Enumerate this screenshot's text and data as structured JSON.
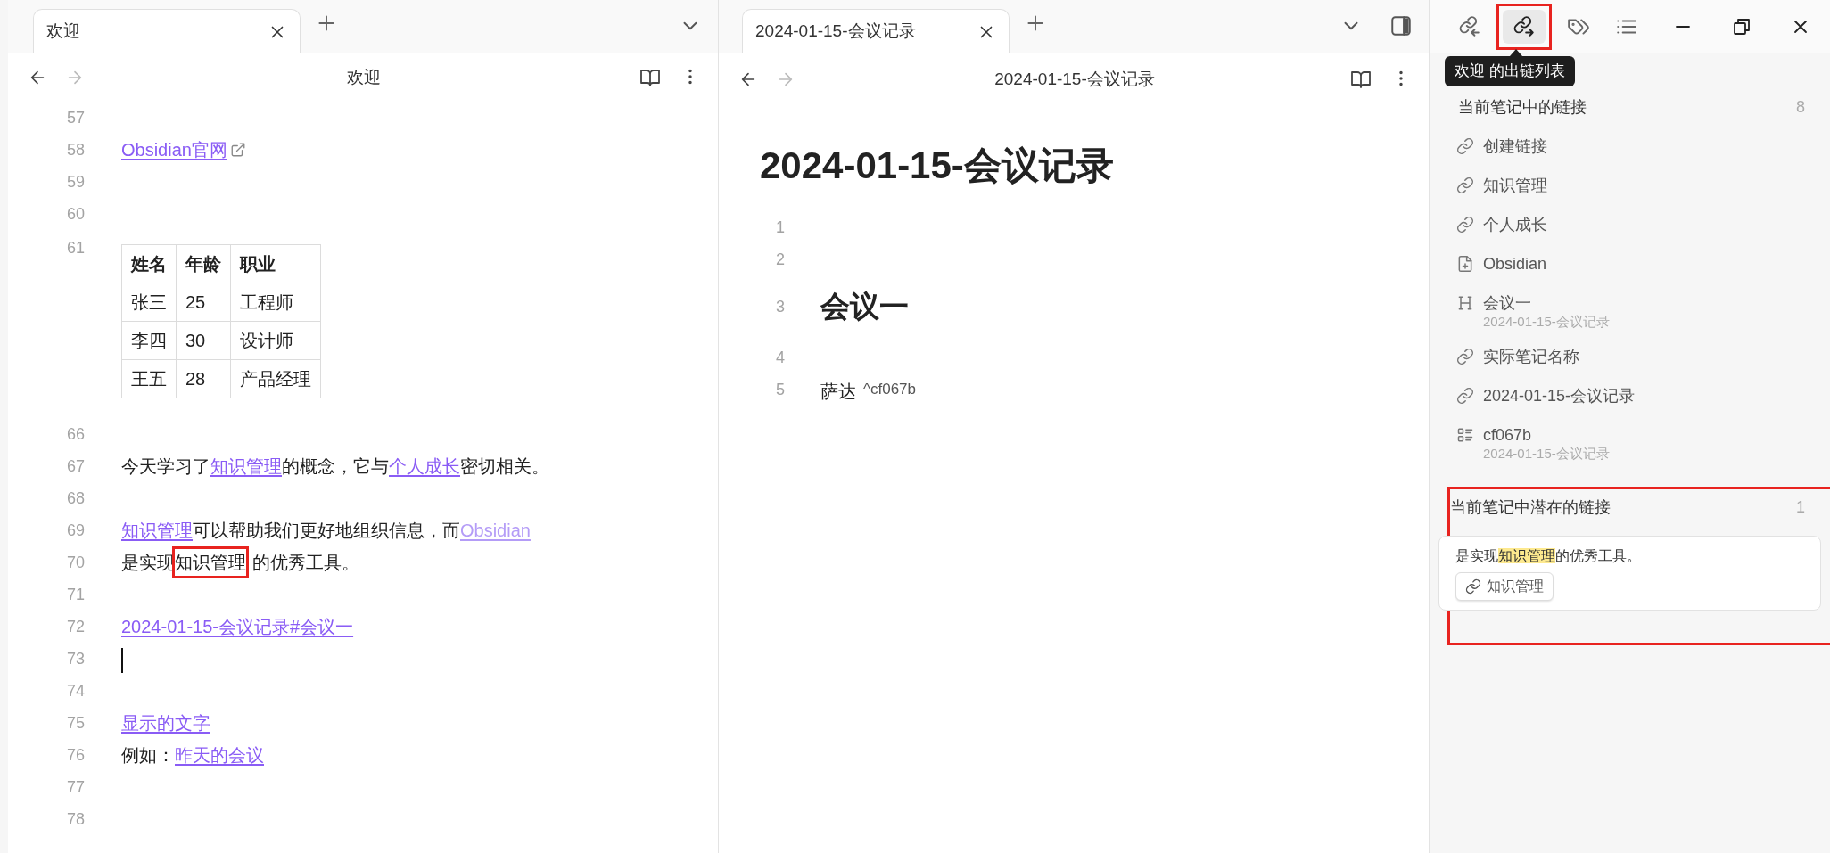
{
  "left_pane": {
    "tab": {
      "label": "欢迎",
      "selected": true
    },
    "header_title": "欢迎",
    "lines": [
      {
        "number": "57",
        "cursor": false
      },
      {
        "number": "58",
        "cursor": false,
        "segments": [
          {
            "kind": "external",
            "text": "Obsidian官网"
          }
        ]
      },
      {
        "number": "59",
        "cursor": false
      },
      {
        "number": "60",
        "cursor": false
      },
      {
        "number": "61",
        "cursor": false,
        "table": {
          "columns": [
            "姓名",
            "年龄",
            "职业"
          ],
          "rows": [
            [
              "张三",
              "25",
              "工程师"
            ],
            [
              "李四",
              "30",
              "设计师"
            ],
            [
              "王五",
              "28",
              "产品经理"
            ]
          ]
        }
      },
      {
        "number": "66",
        "cursor": false
      },
      {
        "number": "67",
        "cursor": false,
        "segments": [
          {
            "kind": "text",
            "text": "今天学习了"
          },
          {
            "kind": "link",
            "text": "知识管理"
          },
          {
            "kind": "text",
            "text": "的概念，它与"
          },
          {
            "kind": "link",
            "text": "个人成长"
          },
          {
            "kind": "text",
            "text": "密切相关。"
          }
        ]
      },
      {
        "number": "68",
        "cursor": false
      },
      {
        "number": "69",
        "cursor": false,
        "segments": [
          {
            "kind": "link",
            "text": "知识管理"
          },
          {
            "kind": "text",
            "text": "可以帮助我们更好地组织信息，而"
          },
          {
            "kind": "unresolved",
            "text": "Obsidian"
          }
        ]
      },
      {
        "number": "70",
        "cursor": false,
        "segments": [
          {
            "kind": "text",
            "text": "是实现"
          },
          {
            "kind": "text",
            "text": "知识管理",
            "framed": true
          },
          {
            "kind": "text",
            "text": "的优秀工具。"
          }
        ]
      },
      {
        "number": "71",
        "cursor": false
      },
      {
        "number": "72",
        "cursor": false,
        "segments": [
          {
            "kind": "link",
            "text": "2024-01-15-会议记录#会议一"
          }
        ]
      },
      {
        "number": "73",
        "cursor": true
      },
      {
        "number": "74",
        "cursor": false
      },
      {
        "number": "75",
        "cursor": false,
        "segments": [
          {
            "kind": "link",
            "text": "显示的文字"
          }
        ]
      },
      {
        "number": "76",
        "cursor": false,
        "segments": [
          {
            "kind": "text",
            "text": "例如："
          },
          {
            "kind": "link",
            "text": "昨天的会议"
          }
        ]
      },
      {
        "number": "77",
        "cursor": false
      },
      {
        "number": "78",
        "cursor": false
      }
    ]
  },
  "middle_pane": {
    "tab": {
      "label": "2024-01-15-会议记录",
      "selected": true
    },
    "header_title": "2024-01-15-会议记录",
    "inline_title": "2024-01-15-会议记录",
    "lines": [
      {
        "number": "1",
        "kind": "blank"
      },
      {
        "number": "2",
        "kind": "blank"
      },
      {
        "number": "3",
        "kind": "heading",
        "text": "会议一"
      },
      {
        "number": "4",
        "kind": "blank"
      },
      {
        "number": "5",
        "kind": "text",
        "text": "萨达",
        "block_id": "^cf067b"
      }
    ]
  },
  "right_panel": {
    "tabs": [
      {
        "kind": "backlinks",
        "selected": false,
        "framed": false
      },
      {
        "kind": "outgoing",
        "selected": true,
        "framed": true
      },
      {
        "kind": "tags",
        "selected": false,
        "framed": false
      },
      {
        "kind": "outline",
        "selected": false,
        "framed": false
      }
    ],
    "tooltip": "欢迎 的出链列表",
    "links_section": {
      "title": "当前笔记中的链接",
      "count": "8",
      "items": [
        {
          "kind": "link",
          "label": "创建链接"
        },
        {
          "kind": "link",
          "label": "知识管理"
        },
        {
          "kind": "link",
          "label": "个人成长"
        },
        {
          "kind": "file",
          "label": "Obsidian"
        },
        {
          "kind": "heading",
          "label": "会议一",
          "path": "2024-01-15-会议记录"
        },
        {
          "kind": "link",
          "label": "实际笔记名称"
        },
        {
          "kind": "link",
          "label": "2024-01-15-会议记录"
        },
        {
          "kind": "block",
          "label": "cf067b",
          "path": "2024-01-15-会议记录"
        }
      ]
    },
    "unlinked_section": {
      "title": "当前笔记中潜在的链接",
      "count": "1",
      "framed": true,
      "results": [
        {
          "context": [
            {
              "text": "是实现",
              "highlighted": false
            },
            {
              "text": "知识管理",
              "highlighted": true
            },
            {
              "text": "的优秀工具。",
              "highlighted": false
            }
          ],
          "link_button": "知识管理"
        }
      ]
    }
  }
}
